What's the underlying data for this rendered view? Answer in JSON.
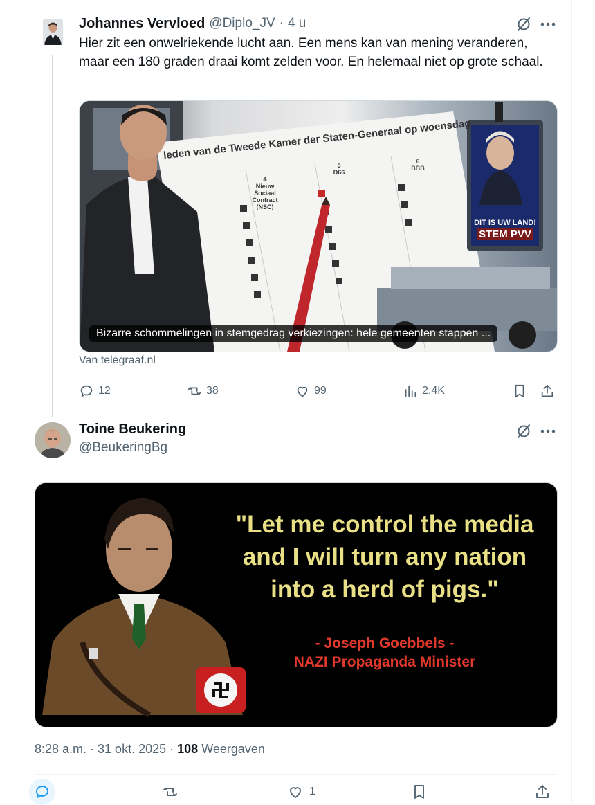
{
  "parent_tweet": {
    "author_name": "Johannes Vervloed",
    "handle": "@Diplo_JV",
    "separator": "·",
    "time": "4 u",
    "text": "Hier zit een onwelriekende lucht aan. Een mens kan van mening veranderen, maar een 180 graden draai komt zelden voor. En helemaal niet op grote schaal.",
    "card": {
      "caption": "Bizarre schommelingen in stemgedrag verkiezingen: hele gemeenten stappen ...",
      "image_text": {
        "headline": "leden van de Tweede Kamer der Staten-Generaal op woensdag",
        "col4_num": "4",
        "col4_name": "Nieuw Sociaal Contract (NSC)",
        "col5_num": "5",
        "col5_name": "D66",
        "col6_num": "6",
        "col6_name": "BBB",
        "billboard_line1": "DIT IS UW LAND!",
        "billboard_line2": "STEM PVV"
      }
    },
    "source": "Van telegraaf.nl",
    "stats": {
      "replies": "12",
      "reposts": "38",
      "likes": "99",
      "views": "2,4K"
    }
  },
  "main_tweet": {
    "author_name": "Toine Beukering",
    "handle": "@BeukeringBg",
    "image_quote": {
      "line1": "\"Let me control the media",
      "line2": "and I will turn any nation",
      "line3": "into a herd of pigs.\"",
      "attribution1": "- Joseph Goebbels -",
      "attribution2": "NAZI Propaganda Minister"
    },
    "timestamp": "8:28 a.m. · 31 okt. 2025 ·",
    "views_count": "108",
    "views_label": "Weergaven",
    "likes": "1"
  },
  "colors": {
    "text_primary": "#0f1419",
    "text_secondary": "#536471",
    "divider": "#eff3f4",
    "accent": "#1d9bf0",
    "quote_text": "#e9e086",
    "attribution_text": "#e0392b"
  },
  "icons": [
    "grok-icon",
    "more-icon",
    "reply-icon",
    "repost-icon",
    "like-icon",
    "views-icon",
    "bookmark-icon",
    "share-icon"
  ]
}
